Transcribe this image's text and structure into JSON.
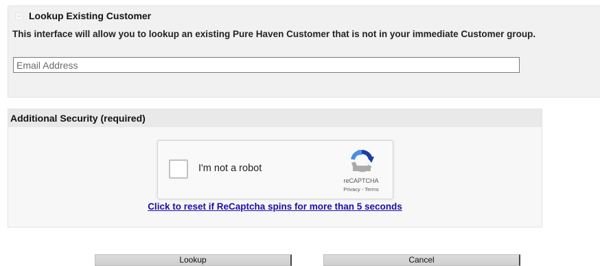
{
  "lookup_panel": {
    "title": "Lookup Existing Customer",
    "description": "This interface will allow you to lookup an existing Pure Haven Customer that is not in your immediate Customer group.",
    "email_placeholder": "Email Address",
    "email_value": ""
  },
  "security_panel": {
    "title": "Additional Security (required)",
    "captcha_label": "I'm not a robot",
    "captcha_brand": "reCAPTCHA",
    "captcha_terms": "Privacy - Terms",
    "reset_link": "Click to reset if ReCaptcha spins for more than 5 seconds"
  },
  "buttons": {
    "lookup": "Lookup",
    "cancel": "Cancel"
  },
  "colors": {
    "link": "#1a0dab",
    "panel_bg": "#f1f1f1",
    "recaptcha_blue": "#1c3aa9",
    "recaptcha_light_blue": "#4a90e2",
    "recaptcha_gray": "#ababab"
  },
  "icons": {
    "collapse": "collapse-icon",
    "recaptcha": "recaptcha-logo-icon"
  }
}
